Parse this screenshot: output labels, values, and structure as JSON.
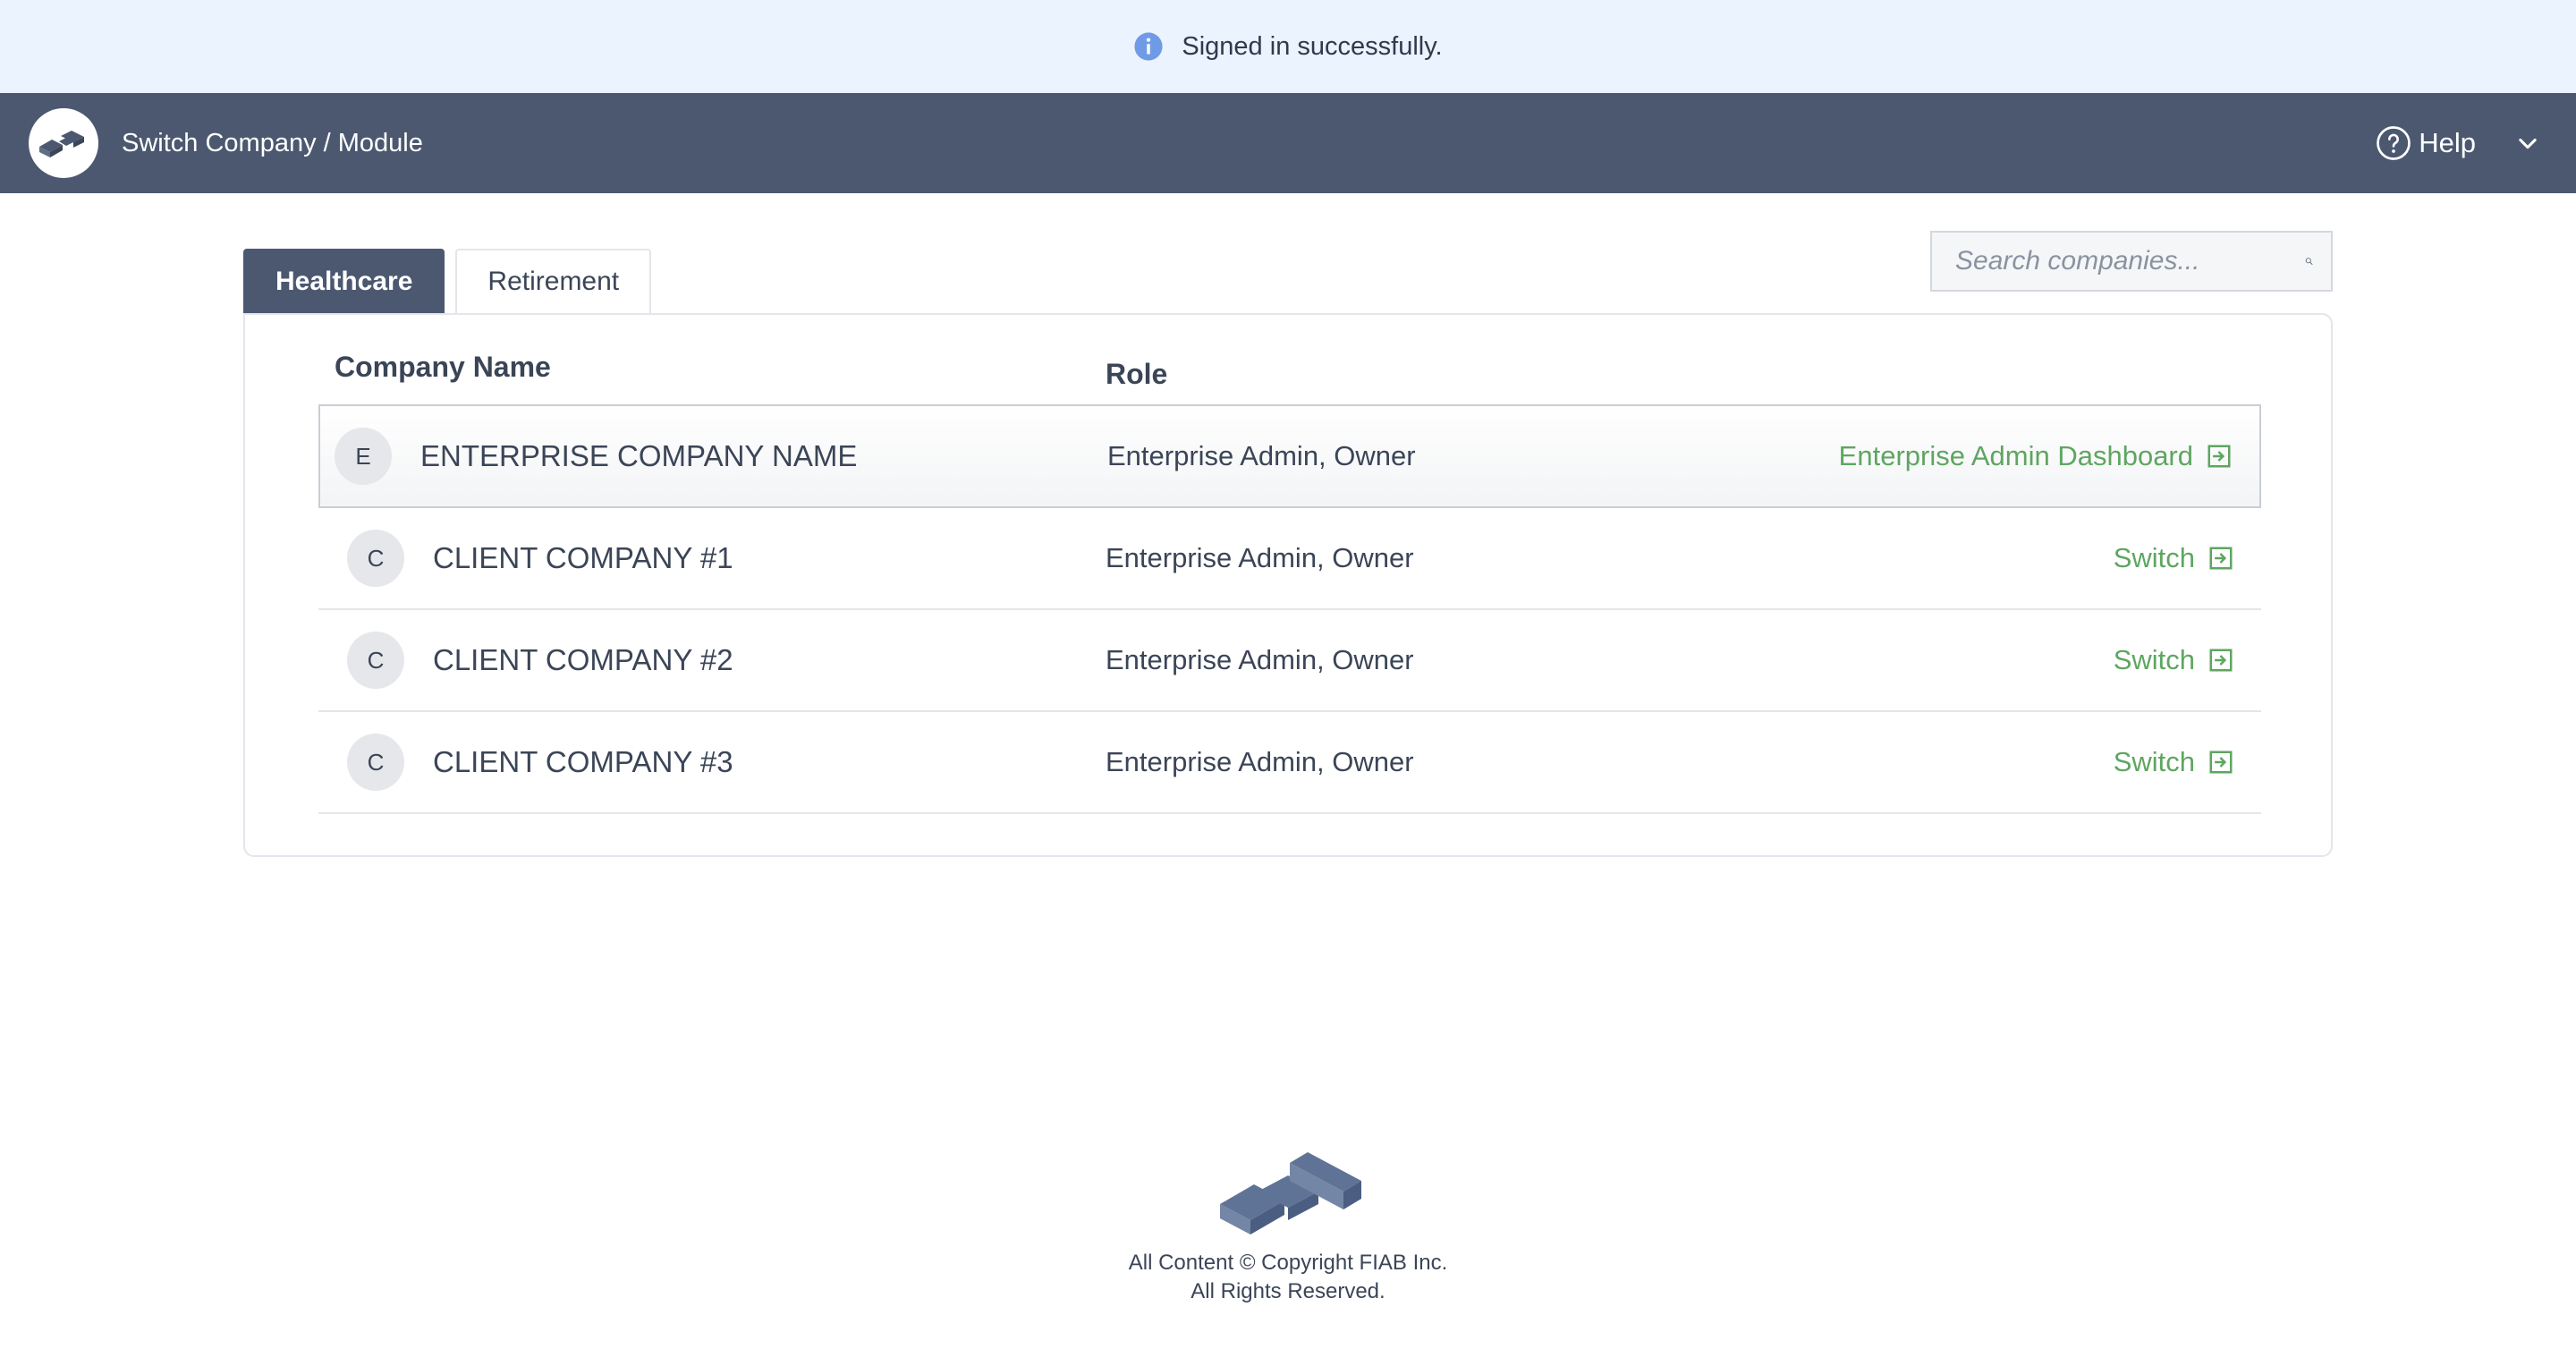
{
  "flash": {
    "message": "Signed in successfully."
  },
  "header": {
    "title": "Switch Company / Module",
    "help_label": "Help"
  },
  "tabs": [
    {
      "label": "Healthcare",
      "active": true
    },
    {
      "label": "Retirement",
      "active": false
    }
  ],
  "search": {
    "placeholder": "Search companies..."
  },
  "table": {
    "columns": {
      "company": "Company Name",
      "role": "Role"
    },
    "rows": [
      {
        "initial": "E",
        "name": "ENTERPRISE COMPANY NAME",
        "role": "Enterprise Admin, Owner",
        "action": "Enterprise Admin Dashboard"
      },
      {
        "initial": "C",
        "name": "CLIENT COMPANY #1",
        "role": "Enterprise Admin, Owner",
        "action": "Switch"
      },
      {
        "initial": "C",
        "name": "CLIENT COMPANY #2",
        "role": "Enterprise Admin, Owner",
        "action": "Switch"
      },
      {
        "initial": "C",
        "name": "CLIENT COMPANY #3",
        "role": "Enterprise Admin, Owner",
        "action": "Switch"
      }
    ]
  },
  "footer": {
    "line1": "All Content © Copyright FIAB Inc.",
    "line2": "All Rights Reserved."
  },
  "colors": {
    "header_bg": "#4b5870",
    "flash_bg": "#ebf3fe",
    "action_green": "#5ea660"
  },
  "icons": {
    "flash": "info-icon",
    "help": "question-circle-icon",
    "menu": "chevron-down-icon",
    "search": "search-icon",
    "action": "arrow-right-square-icon",
    "logo": "brand-logo-icon"
  }
}
